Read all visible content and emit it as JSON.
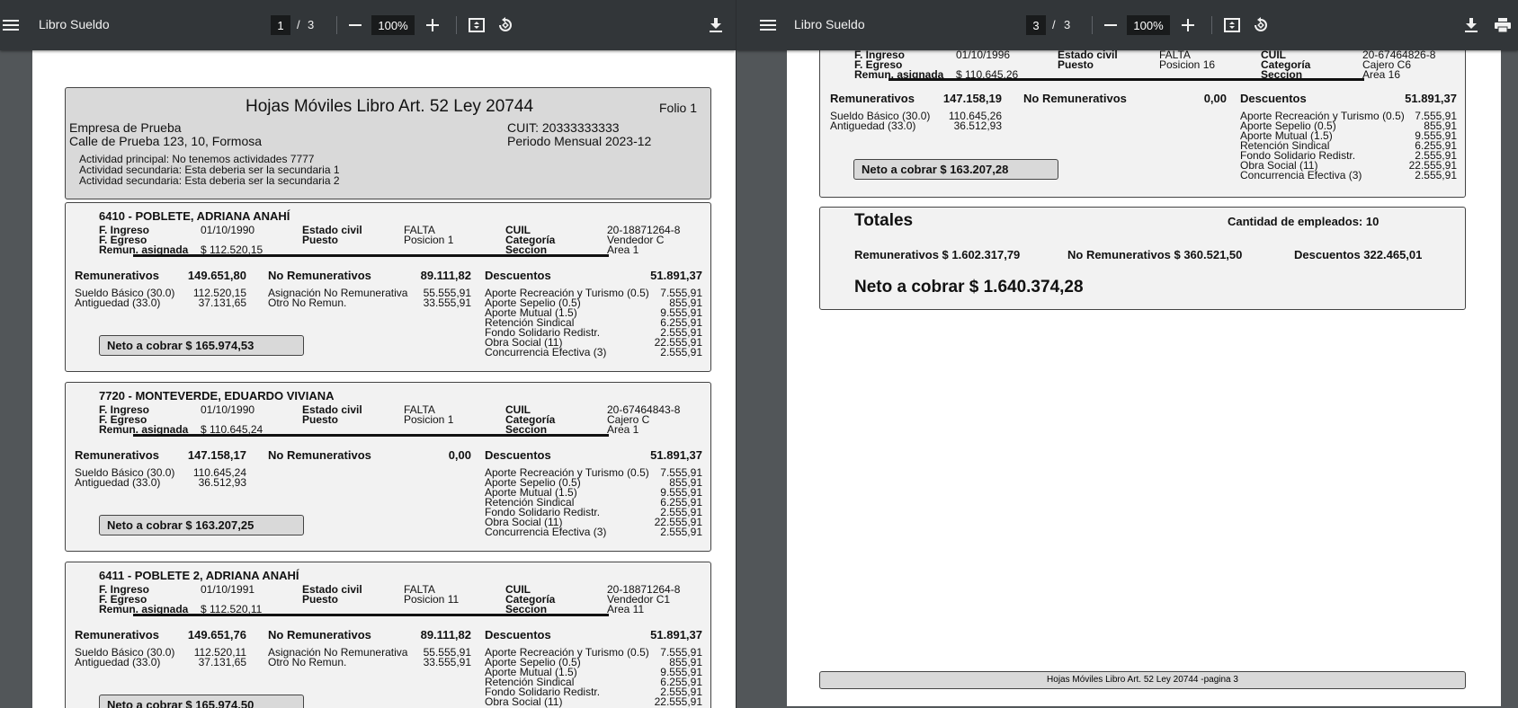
{
  "left_viewer": {
    "title": "Libro Sueldo",
    "page_current": "1",
    "page_sep": "/",
    "page_total": "3",
    "zoom": "100%",
    "header": {
      "title": "Hojas Móviles Libro Art. 52 Ley 20744",
      "folio": "Folio 1",
      "company": "Empresa de Prueba",
      "address": "Calle de Prueba 123, 10, Formosa",
      "cuit": "CUIT: 20333333333",
      "period": "Periodo Mensual 2023-12",
      "activity1": "Actividad principal: No tenemos actividades 7777",
      "activity2": "Actividad secundaria: Esta deberia ser la secundaria 1",
      "activity3": "Actividad secundaria: Esta deberia ser la secundaria 2"
    },
    "employees": [
      {
        "name": "6410 - POBLETE, ADRIANA ANAHÍ",
        "ingreso_label": "F. Ingreso",
        "ingreso": "01/10/1990",
        "egreso_label": "F. Egreso",
        "remun_label": "Remun. asignada",
        "remun": "$  112.520,15",
        "estado_label": "Estado civil",
        "estado": "FALTA",
        "puesto_label": "Puesto",
        "puesto": "Posicion 1",
        "cuil_label": "CUIL",
        "cuil": "20-18871264-8",
        "categoria_label": "Categoría",
        "categoria": "Vendedor C",
        "seccion_label": "Seccion",
        "seccion": "Area 1",
        "rem_label": "Remunerativos",
        "rem_total": "149.651,80",
        "norem_label": "No Remunerativos",
        "norem_total": "89.111,82",
        "desc_label": "Descuentos",
        "desc_total": "51.891,37",
        "rem_items": [
          [
            "Sueldo Básico (30.0)",
            "112.520,15"
          ],
          [
            "Antiguedad (33.0)",
            "37.131,65"
          ]
        ],
        "norem_items": [
          [
            "Asignación No Remunerativa",
            "55.555,91"
          ],
          [
            "Otro No Remun.",
            "33.555,91"
          ]
        ],
        "desc_items": [
          [
            "Aporte Recreación y Turismo (0.5)",
            "7.555,91"
          ],
          [
            "Aporte Sepelio (0.5)",
            "855,91"
          ],
          [
            "Aporte Mutual (1.5)",
            "9.555,91"
          ],
          [
            "Retención Sindical",
            "6.255,91"
          ],
          [
            "Fondo Solidario Redistr.",
            "2.555,91"
          ],
          [
            "Obra Social (11)",
            "22.555,91"
          ],
          [
            "Concurrencia Efectiva (3)",
            "2.555,91"
          ]
        ],
        "neto": "Neto a cobrar   $ 165.974,53"
      },
      {
        "name": "7720 - MONTEVERDE, EDUARDO VIVIANA",
        "ingreso_label": "F. Ingreso",
        "ingreso": "01/10/1990",
        "egreso_label": "F. Egreso",
        "remun_label": "Remun. asignada",
        "remun": "$  110.645,24",
        "estado_label": "Estado civil",
        "estado": "FALTA",
        "puesto_label": "Puesto",
        "puesto": "Posicion 1",
        "cuil_label": "CUIL",
        "cuil": "20-67464843-8",
        "categoria_label": "Categoría",
        "categoria": "Cajero C",
        "seccion_label": "Seccion",
        "seccion": "Area 1",
        "rem_label": "Remunerativos",
        "rem_total": "147.158,17",
        "norem_label": "No Remunerativos",
        "norem_total": "0,00",
        "desc_label": "Descuentos",
        "desc_total": "51.891,37",
        "rem_items": [
          [
            "Sueldo Básico (30.0)",
            "110.645,24"
          ],
          [
            "Antiguedad (33.0)",
            "36.512,93"
          ]
        ],
        "norem_items": [],
        "desc_items": [
          [
            "Aporte Recreación y Turismo (0.5)",
            "7.555,91"
          ],
          [
            "Aporte Sepelio (0.5)",
            "855,91"
          ],
          [
            "Aporte Mutual (1.5)",
            "9.555,91"
          ],
          [
            "Retención Sindical",
            "6.255,91"
          ],
          [
            "Fondo Solidario Redistr.",
            "2.555,91"
          ],
          [
            "Obra Social (11)",
            "22.555,91"
          ],
          [
            "Concurrencia Efectiva (3)",
            "2.555,91"
          ]
        ],
        "neto": "Neto a cobrar   $ 163.207,25"
      },
      {
        "name": "6411 - POBLETE 2, ADRIANA ANAHÍ",
        "ingreso_label": "F. Ingreso",
        "ingreso": "01/10/1991",
        "egreso_label": "F. Egreso",
        "remun_label": "Remun. asignada",
        "remun": "$  112.520,11",
        "estado_label": "Estado civil",
        "estado": "FALTA",
        "puesto_label": "Puesto",
        "puesto": "Posicion 11",
        "cuil_label": "CUIL",
        "cuil": "20-18871264-8",
        "categoria_label": "Categoría",
        "categoria": "Vendedor C1",
        "seccion_label": "Seccion",
        "seccion": "Area 11",
        "rem_label": "Remunerativos",
        "rem_total": "149.651,76",
        "norem_label": "No Remunerativos",
        "norem_total": "89.111,82",
        "desc_label": "Descuentos",
        "desc_total": "51.891,37",
        "rem_items": [
          [
            "Sueldo Básico (30.0)",
            "112.520,11"
          ],
          [
            "Antiguedad (33.0)",
            "37.131,65"
          ]
        ],
        "norem_items": [
          [
            "Asignación No Remunerativa",
            "55.555,91"
          ],
          [
            "Otro No Remun.",
            "33.555,91"
          ]
        ],
        "desc_items": [
          [
            "Aporte Recreación y Turismo (0.5)",
            "7.555,91"
          ],
          [
            "Aporte Sepelio (0.5)",
            "855,91"
          ],
          [
            "Aporte Mutual (1.5)",
            "9.555,91"
          ],
          [
            "Retención Sindical",
            "6.255,91"
          ],
          [
            "Fondo Solidario Redistr.",
            "2.555,91"
          ],
          [
            "Obra Social (11)",
            "22.555,91"
          ]
        ],
        "neto": "Neto a cobrar   $ 165.974,50"
      }
    ]
  },
  "right_viewer": {
    "title": "Libro Sueldo",
    "page_current": "3",
    "page_sep": "/",
    "page_total": "3",
    "zoom": "100%",
    "employee": {
      "ingreso_label": "F. Ingreso",
      "ingreso": "01/10/1996",
      "egreso_label": "F. Egreso",
      "remun_label": "Remun. asignada",
      "remun": "$  110.645,26",
      "estado_label": "Estado civil",
      "estado": "FALTA",
      "puesto_label": "Puesto",
      "puesto": "Posicion 16",
      "cuil_label": "CUIL",
      "cuil": "20-67464826-8",
      "categoria_label": "Categoría",
      "categoria": "Cajero C6",
      "seccion_label": "Seccion",
      "seccion": "Area 16",
      "rem_label": "Remunerativos",
      "rem_total": "147.158,19",
      "norem_label": "No Remunerativos",
      "norem_total": "0,00",
      "desc_label": "Descuentos",
      "desc_total": "51.891,37",
      "rem_items": [
        [
          "Sueldo Básico (30.0)",
          "110.645,26"
        ],
        [
          "Antiguedad (33.0)",
          "36.512,93"
        ]
      ],
      "desc_items": [
        [
          "Aporte Recreación y Turismo (0.5)",
          "7.555,91"
        ],
        [
          "Aporte Sepelio (0.5)",
          "855,91"
        ],
        [
          "Aporte Mutual (1.5)",
          "9.555,91"
        ],
        [
          "Retención Sindical",
          "6.255,91"
        ],
        [
          "Fondo Solidario Redistr.",
          "2.555,91"
        ],
        [
          "Obra Social (11)",
          "22.555,91"
        ],
        [
          "Concurrencia Efectiva (3)",
          "2.555,91"
        ]
      ],
      "neto": "Neto a cobrar   $ 163.207,28"
    },
    "totals": {
      "title": "Totales",
      "count": "Cantidad de empleados: 10",
      "rem": "Remunerativos $ 1.602.317,79",
      "norem": "No Remunerativos $ 360.521,50",
      "desc": "Descuentos 322.465,01",
      "neto": "Neto a cobrar $ 1.640.374,28"
    },
    "footer": "Hojas Móviles Libro Art. 52 Ley 20744 -pagina 3"
  }
}
